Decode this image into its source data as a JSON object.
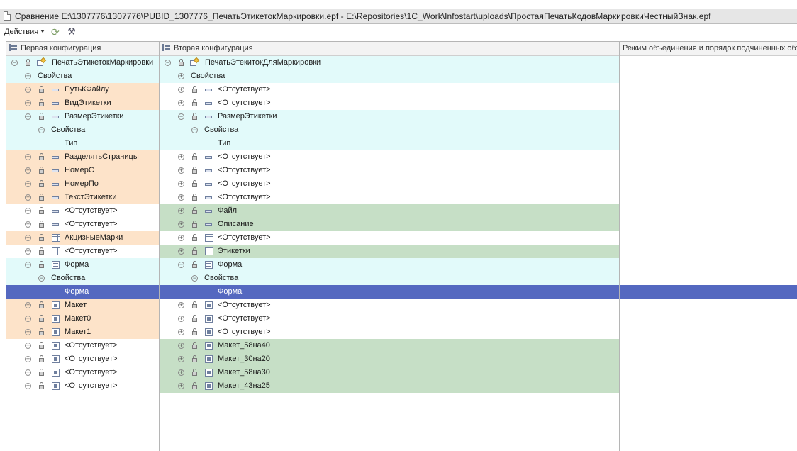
{
  "window": {
    "title": "Сравнение E:\\1307776\\1307776\\PUBID_1307776_ПечатьЭтикетокМаркировки.epf - E:\\Repositories\\1C_Work\\Infostart\\uploads\\ПростаяПечатьКодовМаркировкиЧестныйЗнак.epf"
  },
  "toolbar": {
    "actions_label": "Действия",
    "icons": [
      "refresh-icon",
      "settings-tool-icon"
    ]
  },
  "columns": {
    "first": "Первая конфигурация",
    "second": "Вторая конфигурация",
    "third": "Режим объединения и порядок подчиненных объектов"
  },
  "colors": {
    "orange": "#fde3c9",
    "cyan": "#e2fafa",
    "green": "#c6dfc6",
    "selected": "#5468c0"
  },
  "rows": [
    {
      "level": 0,
      "toggle": "minus",
      "lock": true,
      "icon": "processor-icon",
      "left": "ПечатьЭтикетокМаркировки",
      "right": "ПечатьЭтекитокДляМаркировки",
      "lbg": "cyan",
      "rbg": "cyan"
    },
    {
      "level": 1,
      "toggle": "plus",
      "lock": false,
      "icon": "",
      "left": "Свойства",
      "right": "Свойства",
      "lbg": "cyan",
      "rbg": "cyan"
    },
    {
      "level": 1,
      "toggle": "plus",
      "lock": true,
      "icon": "attribute-icon",
      "left": "ПутьКФайлу",
      "right": "<Отсутствует>",
      "lbg": "orange",
      "rbg": "white"
    },
    {
      "level": 1,
      "toggle": "plus",
      "lock": true,
      "icon": "attribute-icon",
      "left": "ВидЭтикетки",
      "right": "<Отсутствует>",
      "lbg": "orange",
      "rbg": "white"
    },
    {
      "level": 1,
      "toggle": "minus",
      "lock": true,
      "icon": "attribute-icon",
      "left": "РазмерЭтикетки",
      "right": "РазмерЭтикетки",
      "lbg": "cyan",
      "rbg": "cyan"
    },
    {
      "level": 2,
      "toggle": "minus",
      "lock": false,
      "icon": "",
      "left": "Свойства",
      "right": "Свойства",
      "lbg": "cyan",
      "rbg": "cyan"
    },
    {
      "level": 3,
      "toggle": "",
      "lock": false,
      "icon": "",
      "left": "Тип",
      "right": "Тип",
      "lbg": "cyan",
      "rbg": "cyan"
    },
    {
      "level": 1,
      "toggle": "plus",
      "lock": true,
      "icon": "attribute-icon",
      "left": "РазделятьСтраницы",
      "right": "<Отсутствует>",
      "lbg": "orange",
      "rbg": "white"
    },
    {
      "level": 1,
      "toggle": "plus",
      "lock": true,
      "icon": "attribute-icon",
      "left": "НомерС",
      "right": "<Отсутствует>",
      "lbg": "orange",
      "rbg": "white"
    },
    {
      "level": 1,
      "toggle": "plus",
      "lock": true,
      "icon": "attribute-icon",
      "left": "НомерПо",
      "right": "<Отсутствует>",
      "lbg": "orange",
      "rbg": "white"
    },
    {
      "level": 1,
      "toggle": "plus",
      "lock": true,
      "icon": "attribute-icon",
      "left": "ТекстЭтикетки",
      "right": "<Отсутствует>",
      "lbg": "orange",
      "rbg": "white"
    },
    {
      "level": 1,
      "toggle": "plus",
      "lock": true,
      "icon": "attribute-icon",
      "left": "<Отсутствует>",
      "right": "Файл",
      "lbg": "white",
      "rbg": "green"
    },
    {
      "level": 1,
      "toggle": "plus",
      "lock": true,
      "icon": "attribute-icon",
      "left": "<Отсутствует>",
      "right": "Описание",
      "lbg": "white",
      "rbg": "green"
    },
    {
      "level": 1,
      "toggle": "plus",
      "lock": true,
      "icon": "table-icon",
      "left": "АкцизныеМарки",
      "right": "<Отсутствует>",
      "lbg": "orange",
      "rbg": "white"
    },
    {
      "level": 1,
      "toggle": "plus",
      "lock": true,
      "icon": "table-icon",
      "left": "<Отсутствует>",
      "right": "Этикетки",
      "lbg": "white",
      "rbg": "green"
    },
    {
      "level": 1,
      "toggle": "minus",
      "lock": true,
      "icon": "form-icon",
      "left": "Форма",
      "right": "Форма",
      "lbg": "cyan",
      "rbg": "cyan"
    },
    {
      "level": 2,
      "toggle": "minus",
      "lock": false,
      "icon": "",
      "left": "Свойства",
      "right": "Свойства",
      "lbg": "cyan",
      "rbg": "cyan"
    },
    {
      "level": 3,
      "toggle": "",
      "lock": false,
      "icon": "",
      "left": "Форма",
      "right": "Форма",
      "lbg": "sel",
      "rbg": "sel",
      "selected": true
    },
    {
      "level": 1,
      "toggle": "plus",
      "lock": true,
      "icon": "template-icon",
      "left": "Макет",
      "right": "<Отсутствует>",
      "lbg": "orange",
      "rbg": "white"
    },
    {
      "level": 1,
      "toggle": "plus",
      "lock": true,
      "icon": "template-icon",
      "left": "Макет0",
      "right": "<Отсутствует>",
      "lbg": "orange",
      "rbg": "white"
    },
    {
      "level": 1,
      "toggle": "plus",
      "lock": true,
      "icon": "template-icon",
      "left": "Макет1",
      "right": "<Отсутствует>",
      "lbg": "orange",
      "rbg": "white"
    },
    {
      "level": 1,
      "toggle": "plus",
      "lock": true,
      "icon": "template-icon",
      "left": "<Отсутствует>",
      "right": "Макет_58на40",
      "lbg": "white",
      "rbg": "green"
    },
    {
      "level": 1,
      "toggle": "plus",
      "lock": true,
      "icon": "template-icon",
      "left": "<Отсутствует>",
      "right": "Макет_30на20",
      "lbg": "white",
      "rbg": "green"
    },
    {
      "level": 1,
      "toggle": "plus",
      "lock": true,
      "icon": "template-icon",
      "left": "<Отсутствует>",
      "right": "Макет_58на30",
      "lbg": "white",
      "rbg": "green"
    },
    {
      "level": 1,
      "toggle": "plus",
      "lock": true,
      "icon": "template-icon",
      "left": "<Отсутствует>",
      "right": "Макет_43на25",
      "lbg": "white",
      "rbg": "green"
    }
  ]
}
